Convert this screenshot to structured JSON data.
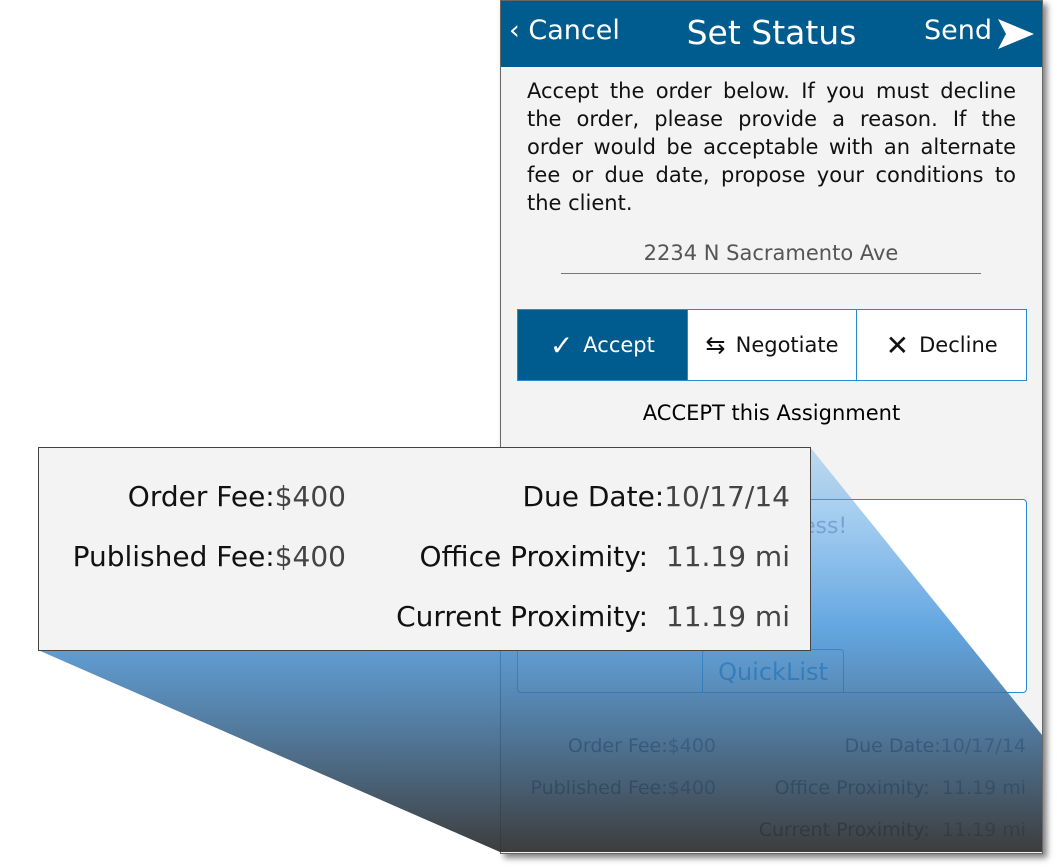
{
  "header": {
    "cancel": "Cancel",
    "title": "Set Status",
    "send": "Send"
  },
  "intro": "Accept the order below. If you must decline the order, please provide a reason. If the order would be acceptable with an alternate fee or due date, propose your conditions to the client.",
  "address": "2234 N Sacramento Ave",
  "segments": {
    "accept": "Accept",
    "negotiate": "Negotiate",
    "decline": "Decline",
    "selected": "Accept"
  },
  "status_text": "ACCEPT this Assignment",
  "message": {
    "placeholder": "ness!",
    "quicklist": "QuickList"
  },
  "details": {
    "order_fee_label": "Order Fee:",
    "order_fee": "$400",
    "published_fee_label": "Published Fee:",
    "published_fee": "$400",
    "due_date_label": "Due Date:",
    "due_date": "10/17/14",
    "office_prox_label": "Office Proximity:",
    "office_prox": "11.19 mi",
    "current_prox_label": "Current Proximity:",
    "current_prox": "11.19 mi"
  },
  "colors": {
    "header": "#005b8e",
    "accent": "#2a8ad0"
  }
}
